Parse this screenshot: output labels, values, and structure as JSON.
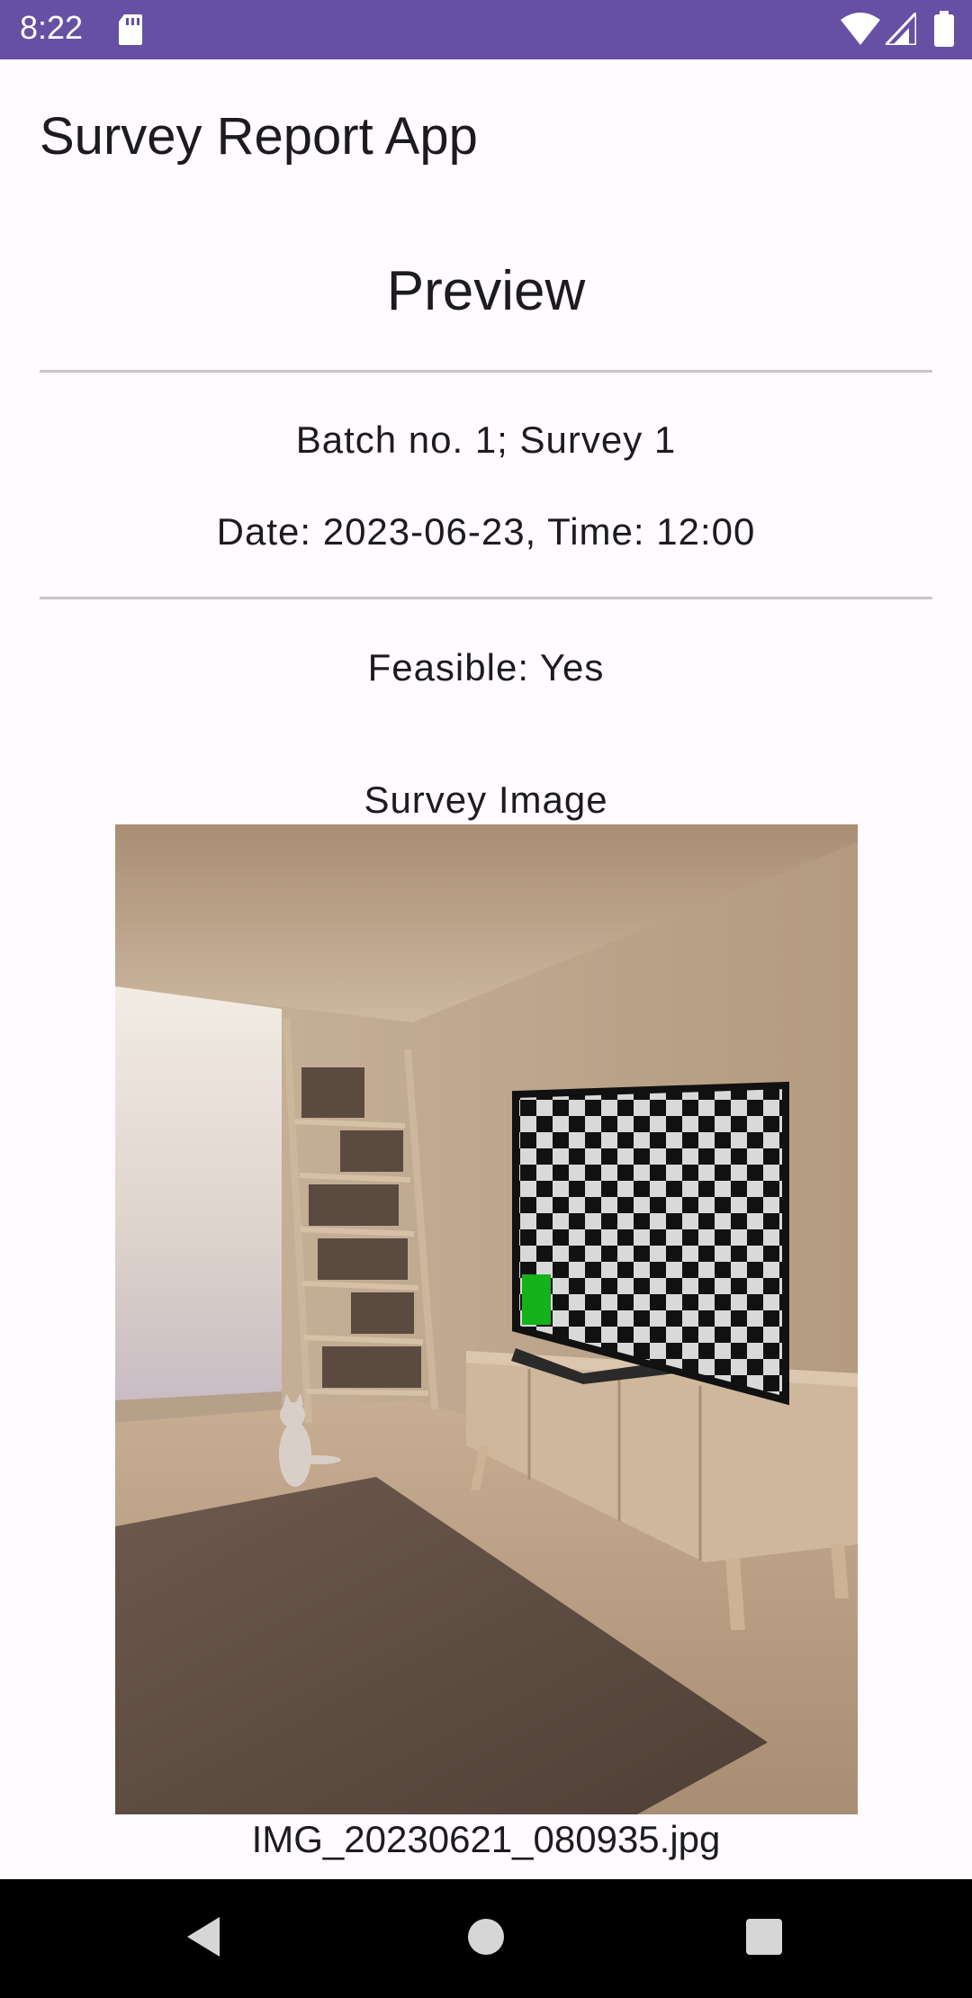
{
  "status_bar": {
    "time": "8:22",
    "icons": [
      "sd-card-icon",
      "wifi-icon",
      "signal-icon",
      "battery-icon"
    ]
  },
  "app": {
    "title": "Survey Report App"
  },
  "preview": {
    "heading": "Preview",
    "batch_line": "Batch no. 1; Survey 1",
    "datetime_line": "Date: 2023-06-23, Time: 12:00",
    "feasible_line": "Feasible: Yes",
    "image_label": "Survey Image",
    "file_name": "IMG_20230621_080935.jpg"
  },
  "nav_bar": {
    "icons": [
      "back-icon",
      "home-icon",
      "recents-icon"
    ]
  },
  "colors": {
    "status_bar": "#6650a4",
    "background": "#fffbfe",
    "divider": "#c8c6cc",
    "nav_bar": "#000000"
  }
}
